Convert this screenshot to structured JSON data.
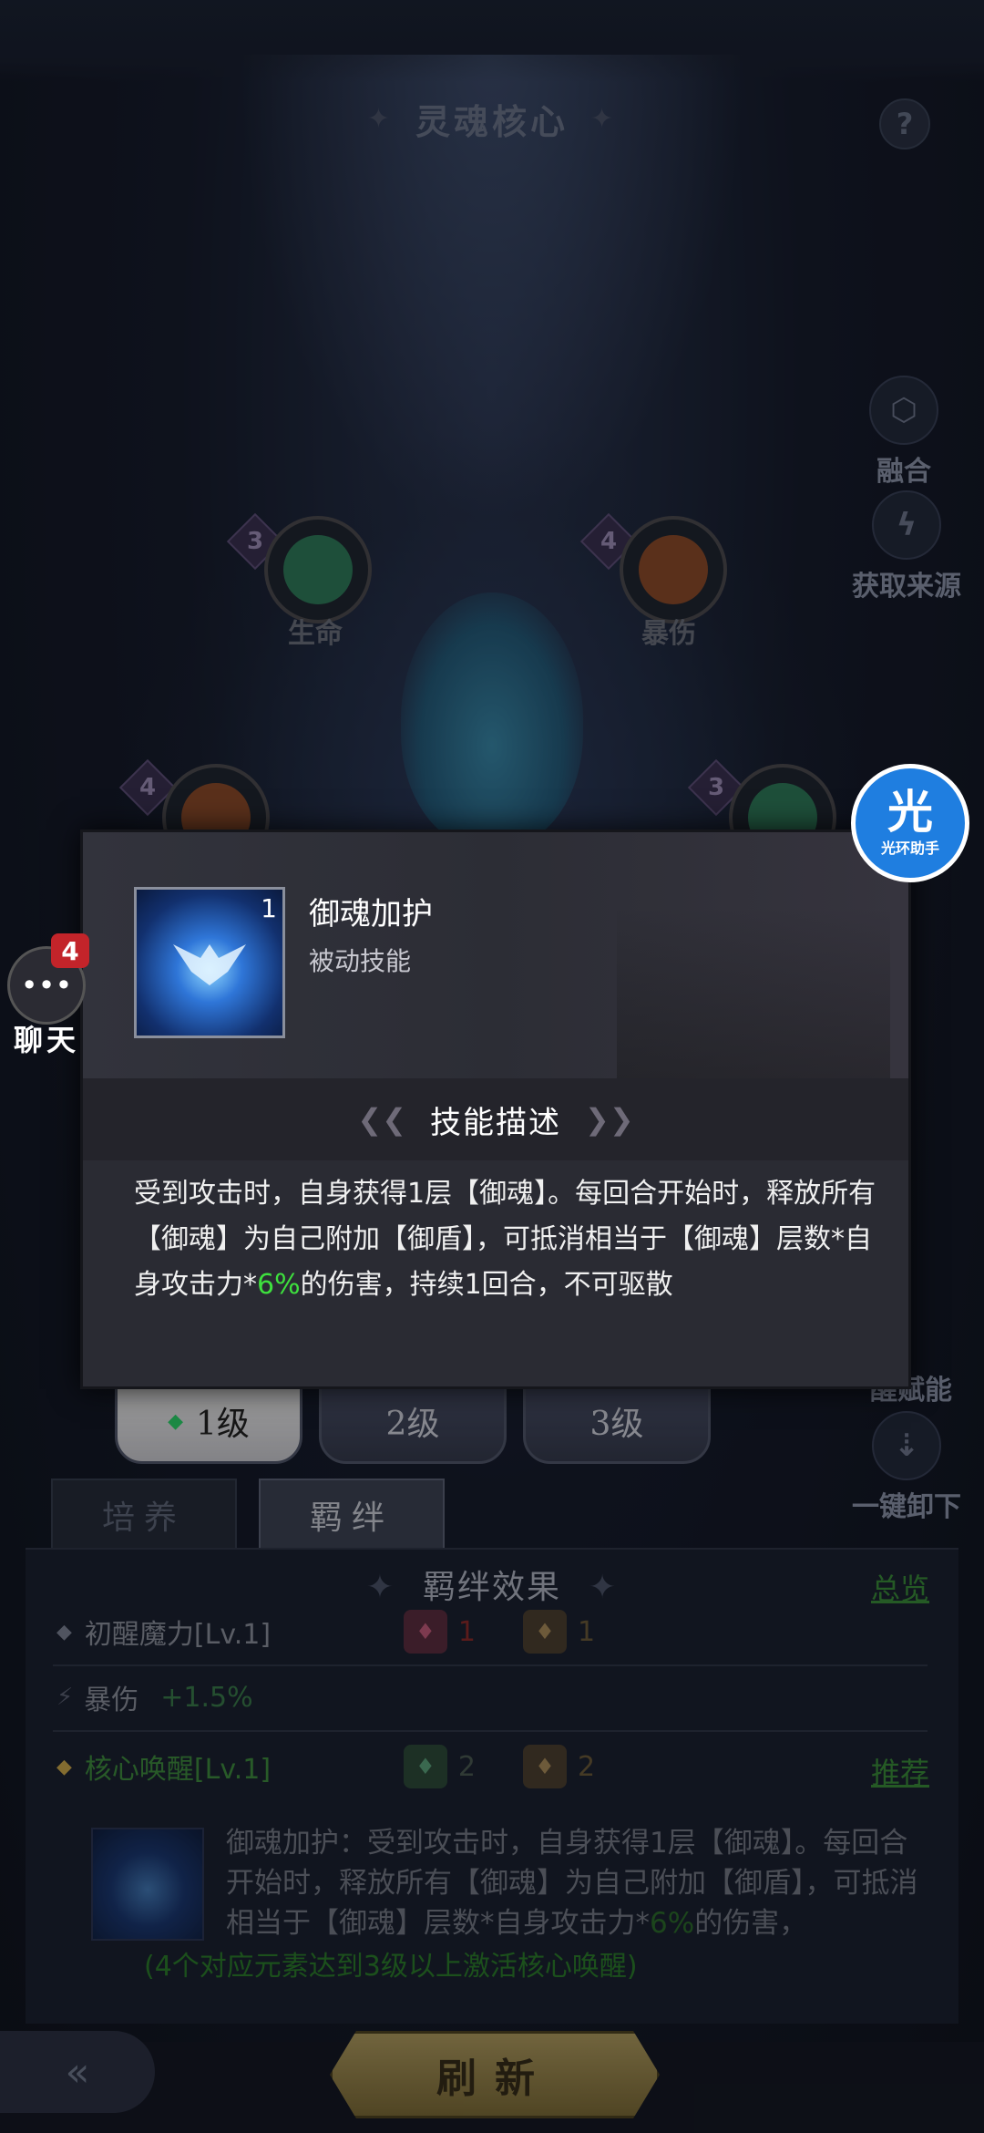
{
  "header": {
    "title": "灵魂核心",
    "help": "?"
  },
  "side_buttons": [
    {
      "label": "融合",
      "icon": "hexagon-cluster-icon"
    },
    {
      "label": "获取来源",
      "icon": "lightning-icon"
    },
    {
      "label": "醒赋能",
      "icon": "flame-icon"
    },
    {
      "label": "一键卸下",
      "icon": "unequip-icon"
    }
  ],
  "elements": [
    {
      "label": "生命",
      "level": "3",
      "color": "#3a9a6a"
    },
    {
      "label": "暴伤",
      "level": "4",
      "color": "#b26a3a"
    },
    {
      "label": "",
      "level": "4",
      "color": "#b26a3a"
    },
    {
      "label": "",
      "level": "3",
      "color": "#3a8a6a"
    }
  ],
  "popup": {
    "skill_name": "御魂加护",
    "skill_type": "被动技能",
    "icon_level": "1",
    "desc_title": "技能描述",
    "desc_part1": "受到攻击时，自身获得1层【御魂】。每回合开始时，释放所有【御魂】为自己附加【御盾】，可抵消相当于【御魂】层数*自身攻击力*",
    "desc_highlight": "6%",
    "desc_part2": "的伤害，持续1回合，不可驱散"
  },
  "assist": {
    "big": "光",
    "small": "光环助手"
  },
  "chat": {
    "label": "聊天",
    "badge": "4"
  },
  "level_tabs": [
    "1级",
    "2级",
    "3级"
  ],
  "tabs": [
    "培养",
    "羁绊"
  ],
  "bond": {
    "title": "羁绊效果",
    "overview": "总览",
    "row1": {
      "name": "初醒魔力[Lv.1]",
      "count1": "1",
      "count2": "1"
    },
    "row1_stat": {
      "name": "暴伤",
      "value": "+1.5%"
    },
    "row2": {
      "name": "核心唤醒[Lv.1]",
      "count1": "2",
      "count2": "2",
      "recommend": "推荐"
    },
    "core_text_line1": "御魂加护：受到攻击时，自身获得1层【御魂】。每回合开始时，释放所有【御魂】为自己附加【御盾】，可抵消相当于【御魂】层数*自身攻击力*",
    "core_highlight": "6%",
    "core_text_line2": "的伤害，",
    "core_note": "(4个对应元素达到3级以上激活核心唤醒)"
  },
  "bottom": {
    "refresh": "刷新",
    "back": "«"
  },
  "colors": {
    "accent_green": "#3ee03e",
    "assist_blue": "#1f7ee0",
    "badge_red": "#c3242a"
  }
}
